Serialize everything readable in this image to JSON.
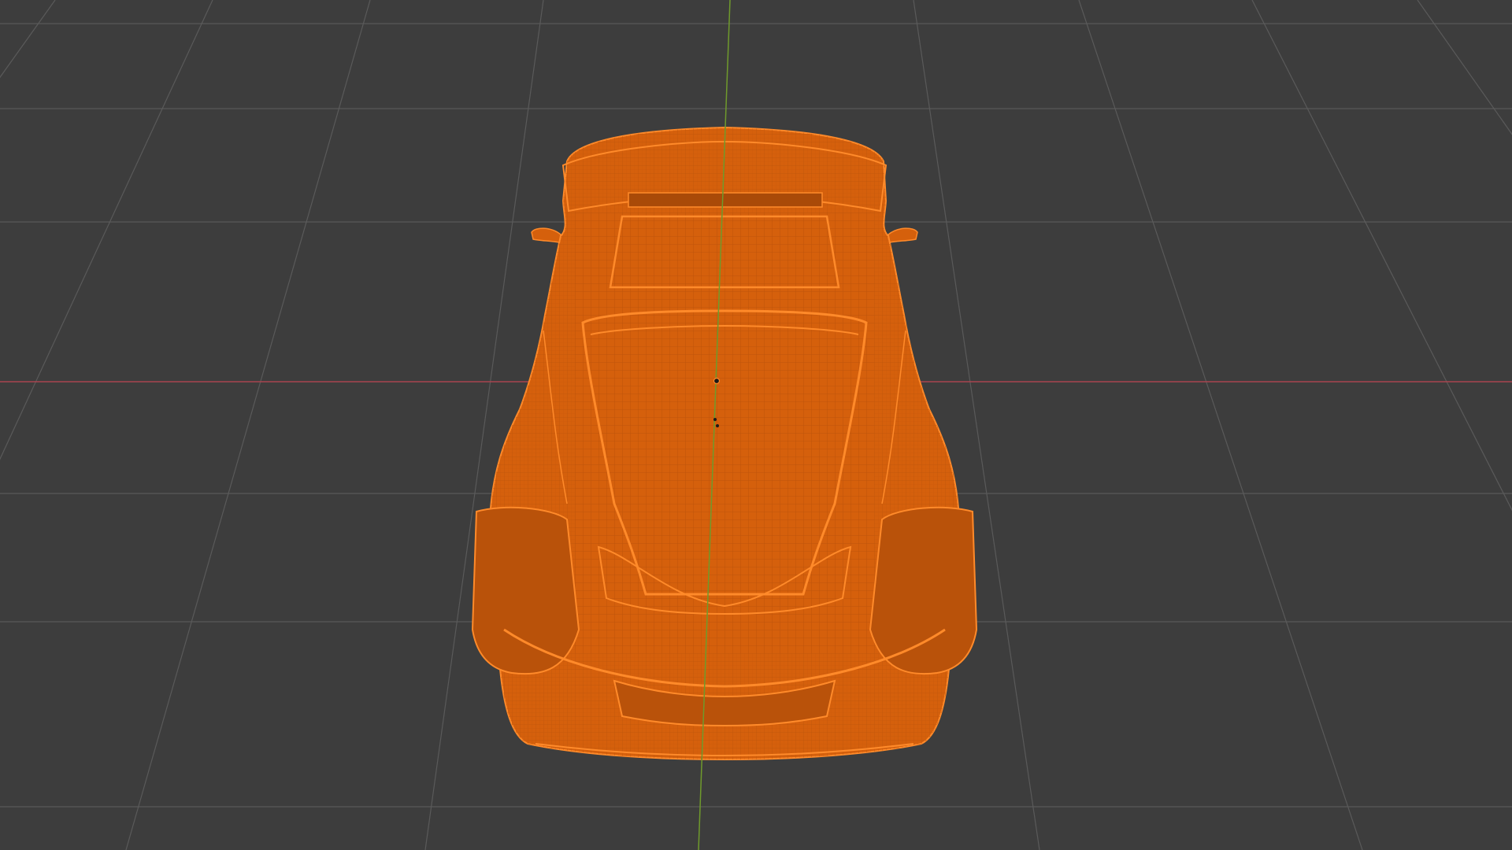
{
  "viewport": {
    "background": "#3d3d3d",
    "grid_color": "#5a5a5a",
    "x_axis_color": "#a8454f",
    "y_axis_color": "#6f9a2c"
  },
  "object": {
    "kind": "car-mesh-wireframe",
    "wire_color": "#e86a10",
    "fill_color": "#d5600c",
    "highlight_color": "#ff8a2a",
    "selected": true,
    "origin_color": "#1a1a1a"
  },
  "icons": {
    "origin": "object-origin-dot-icon"
  }
}
